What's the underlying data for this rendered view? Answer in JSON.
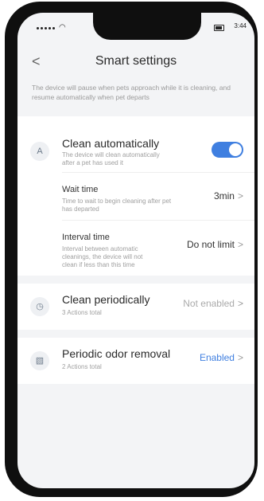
{
  "status": {
    "time": "3:44"
  },
  "header": {
    "title": "Smart settings",
    "back_glyph": "<"
  },
  "description": "The device will pause when pets approach while it is cleaning, and resume automatically when pet departs",
  "clean_auto": {
    "icon_letter": "A",
    "title": "Clean automatically",
    "subtitle": "The device will clean automatically after a pet has used it",
    "enabled": true,
    "wait_time": {
      "label": "Wait time",
      "desc": "Time to wait to begin cleaning after pet has departed",
      "value": "3min"
    },
    "interval_time": {
      "label": "Interval time",
      "desc": "Interval between automatic cleanings, the device will not clean if less than this time",
      "value": "Do not limit"
    }
  },
  "clean_periodic": {
    "icon": "clock-icon",
    "title": "Clean periodically",
    "subtitle": "3 Actions total",
    "value": "Not enabled"
  },
  "odor": {
    "icon": "odor-icon",
    "title": "Periodic odor removal",
    "subtitle": "2 Actions total",
    "value": "Enabled"
  },
  "colors": {
    "accent": "#3f7fe0",
    "toggle_on": "#3f7fe0"
  },
  "chevron": ">"
}
